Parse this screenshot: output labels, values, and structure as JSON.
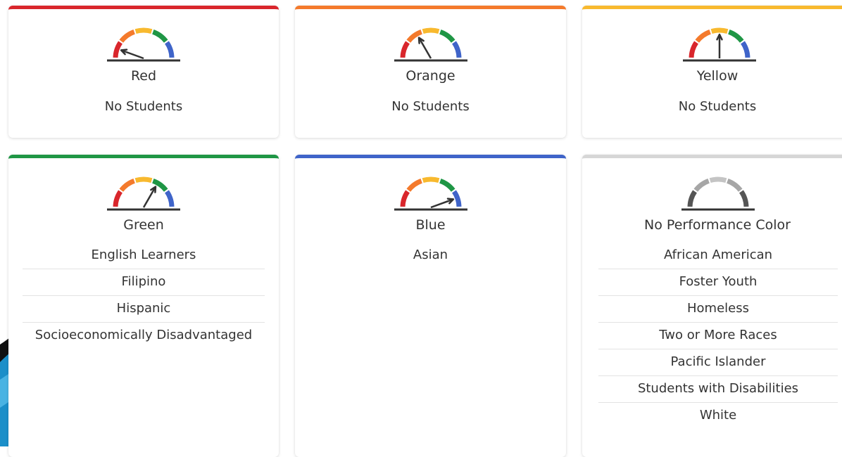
{
  "colors": {
    "red": "#d9262c",
    "orange": "#f47a2c",
    "yellow": "#f8b92e",
    "green": "#1f9645",
    "blue": "#3f64c9",
    "gray": "#d6d6d6",
    "needle": "#333333"
  },
  "cards": [
    {
      "id": "red",
      "label": "Red",
      "level": "red",
      "empty_text": "No Students",
      "groups": []
    },
    {
      "id": "orange",
      "label": "Orange",
      "level": "orange",
      "empty_text": "No Students",
      "groups": []
    },
    {
      "id": "yellow",
      "label": "Yellow",
      "level": "yellow",
      "empty_text": "No Students",
      "groups": []
    },
    {
      "id": "green",
      "label": "Green",
      "level": "green",
      "empty_text": "",
      "groups": [
        "English Learners",
        "Filipino",
        "Hispanic",
        "Socioeconomically Disadvantaged"
      ]
    },
    {
      "id": "blue",
      "label": "Blue",
      "level": "blue",
      "empty_text": "",
      "groups": [
        "Asian"
      ]
    },
    {
      "id": "none",
      "label": "No Performance Color",
      "level": "none",
      "empty_text": "",
      "groups": [
        "African American",
        "Foster Youth",
        "Homeless",
        "Two or More Races",
        "Pacific Islander",
        "Students with Disabilities",
        "White"
      ]
    }
  ]
}
